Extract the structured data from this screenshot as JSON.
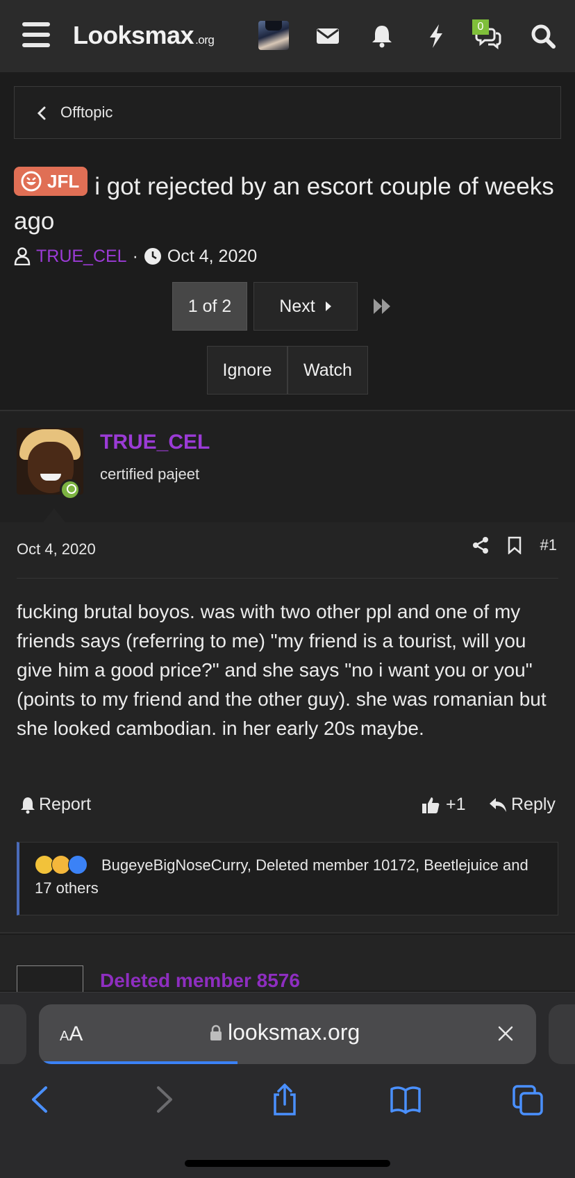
{
  "nav": {
    "logo_main": "Looksmax",
    "logo_suffix": ".org",
    "conversations_badge": "0"
  },
  "breadcrumb": {
    "label": "Offtopic"
  },
  "thread": {
    "prefix": "JFL",
    "title": "i got rejected by an escort couple of weeks ago",
    "author": "TRUE_CEL",
    "date": "Oct 4, 2020"
  },
  "pagination": {
    "current": "1 of 2",
    "next_label": "Next"
  },
  "thread_actions": {
    "ignore": "Ignore",
    "watch": "Watch"
  },
  "post": {
    "author": "TRUE_CEL",
    "user_title": "certified pajeet",
    "date": "Oct 4, 2020",
    "number": "#1",
    "body": "fucking brutal boyos. was with two other ppl and one of my friends says (referring to me) \"my friend is a tourist, will you give him a good price?\" and she says \"no i want you or you\" (points to my friend and the other guy). she was romanian but she looked cambodian. in her early 20s maybe.",
    "report": "Report",
    "like_count": "+1",
    "reply": "Reply",
    "reactions_text": "BugeyeBigNoseCurry, Deleted member 10172, Beetlejuice and 17 others"
  },
  "next_post": {
    "author": "Deleted member 8576"
  },
  "browser": {
    "aa_label": "AA",
    "host": "looksmax.org",
    "load_progress": 0.4
  },
  "colors": {
    "username": "#9b3bd6",
    "prefix_bg": "#e06f55",
    "online": "#7cb342",
    "accent_blue": "#3b82f6"
  }
}
